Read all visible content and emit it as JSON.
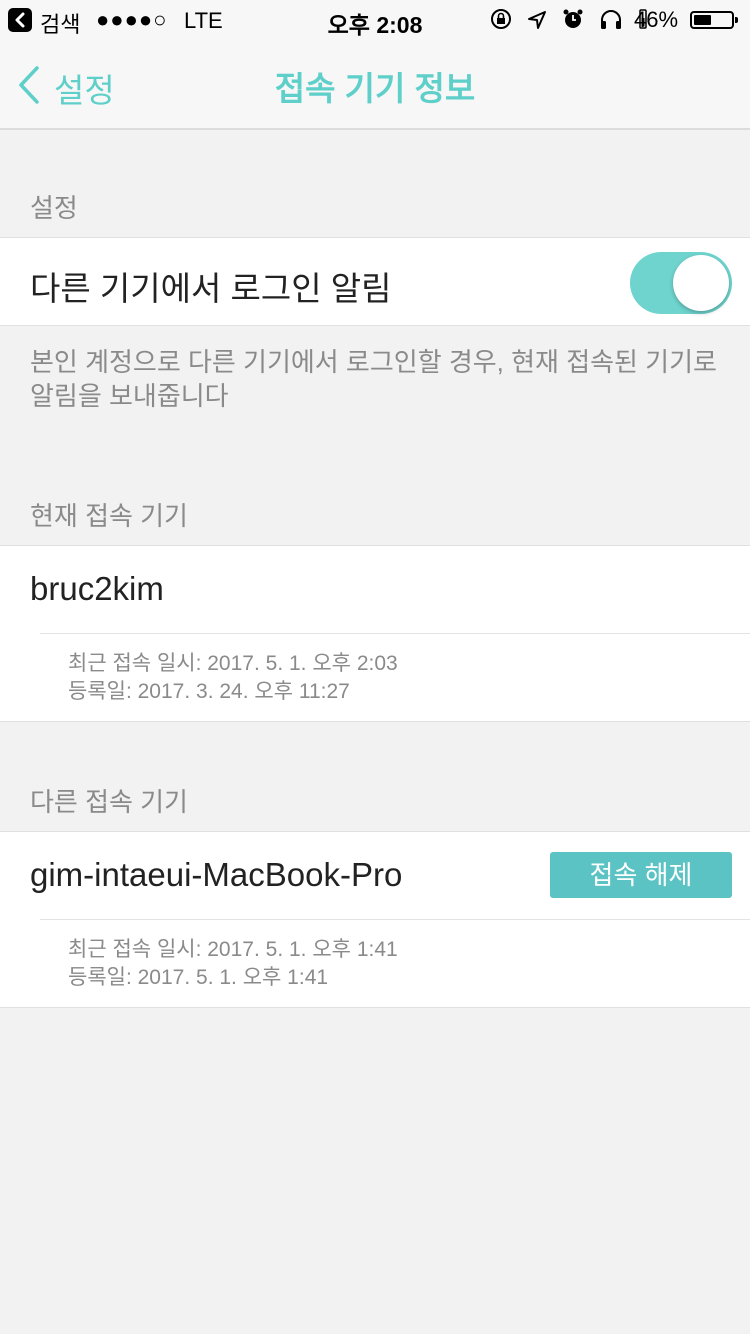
{
  "status_bar": {
    "app_name": "검색",
    "signal": "●●●●○",
    "carrier": "LTE",
    "time": "오후 2:08",
    "battery_percent": "46%",
    "battery_level": 0.46
  },
  "nav": {
    "back_label": "설정",
    "title": "접속 기기 정보"
  },
  "settings_section": {
    "header": "설정",
    "login_alert_label": "다른 기기에서 로그인 알림",
    "login_alert_on": true,
    "description": "본인 계정으로 다른 기기에서 로그인할 경우, 현재 접속된 기기로 알림을 보내줍니다"
  },
  "current_device_section": {
    "header": "현재 접속 기기",
    "device_name": "bruc2kim",
    "last_access": "최근 접속 일시: 2017. 5. 1. 오후 2:03",
    "registered": "등록일: 2017. 3. 24. 오후 11:27"
  },
  "other_device_section": {
    "header": "다른 접속 기기",
    "device_name": "gim-intaeui-MacBook-Pro",
    "disconnect_label": "접속 해제",
    "last_access": "최근 접속 일시: 2017. 5. 1. 오후 1:41",
    "registered": "등록일: 2017. 5. 1. 오후 1:41"
  }
}
